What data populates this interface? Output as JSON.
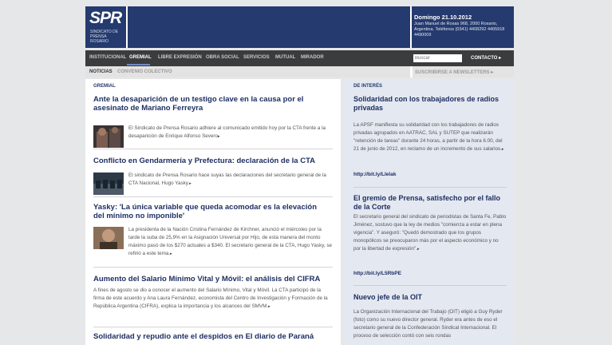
{
  "logo": {
    "text": "SPR",
    "subtitle": "SINDICATO DE PRENSA ROSARIO"
  },
  "date": "Domingo 21.10.2012",
  "address": "Juan Manuel de Rosas 968, 2000 Rosario, Argentina. Teléfonos (0341) 4408292 4405918 4490009",
  "nav": [
    "INSTITUCIONAL",
    "GREMIAL",
    "LIBRE EXPRESIÓN",
    "OBRA SOCIAL",
    "SERVICIOS",
    "MUTUAL",
    "MIRADOR"
  ],
  "search_placeholder": "Buscar",
  "contact": "CONTACTO ▸",
  "subnav": [
    "NOTICIAS",
    "CONVENIO COLECTIVO"
  ],
  "newsletter": "SUSCRIBIRSE A NEWSLETTERS ▸",
  "section": "GREMIAL",
  "articles": [
    {
      "title": "Ante la desaparición de un testigo clave en la causa por el asesinato de Mariano Ferreyra",
      "body": "El Sindicato de Prensa Rosario adhiere al comunicado emitido hoy por la CTA frente a la desaparición de Enrique Alfonso Severo"
    },
    {
      "title": "Conflicto en Gendarmería y Prefectura: declaración de la CTA",
      "body": "El sindicato de Prensa Rosario hace suyas las declaraciones del secretario general de la CTA Nacional, Hugo Yasky."
    },
    {
      "title": "Yasky: 'La única variable que queda acomodar es la elevación del mínimo no imponible'",
      "body": "La presidenta de la Nación Cristina Fernández de Kirchner, anunció el miércoles por la tarde la suba de 25,9% en la Asignación Universal por Hijo, de esta manera del monto máximo pasó de los $270 actuales a $340. El secretario general de la CTA, Hugo Yasky, se refirió a este tema."
    },
    {
      "title": "Aumento del Salario Mínimo Vital y Móvil: el análisis del CIFRA",
      "body": "A fines de agosto se dio a conocer el aumento del Salario Mínimo, Vital y Móvil. La CTA participó de la firma de este acuerdo y Ana Laura Fernández, economista del Centro de Investigación y Formación de la República Argentina (CIFRA), explica la importancia y los alcances del SMVM."
    },
    {
      "title": "Solidaridad y repudio ante el despidos en El diario de Paraná",
      "body": ""
    }
  ],
  "sidebar_section": "DE INTERÉS",
  "sidebar": [
    {
      "title": "Solidaridad con los trabajadores de radios privadas",
      "body": "La APSF manifiesta su solidaridad con los trabajadores de radios privadas agrupados en AATRAC, SAL y SUTEP que realizarán \"retención de tareas\" durante 24 horas, a partir de la hora 6.00, del 21 de junio de 2012, en reclamo de un incremento de sus salarios.",
      "link": "http://bit.ly/Llelak"
    },
    {
      "title": "El gremio de Prensa, satisfecho por el fallo de la Corte",
      "body": "El secretario general del sindicato de periodistas de Santa Fe, Pablo Jiménez, sostuvo que la ley de medios \"comienza a estar en plena vigencia\". Y aseguró: \"Quedó demostrado que los grupos monopólicos se preocuparon más por el aspecto económico y no por la libertad de expresión\".",
      "link": "http://bit.ly/L5RbPE"
    },
    {
      "title": "Nuevo jefe de la OIT",
      "body": "La Organización Internacional del Trabajo (OIT) eligió a Guy Ryder (foto) como su nuevo director general. Ryder era antes de eso el secretario general de la Confederación Sindical Internacional. El proceso de selección contó con seis rondas",
      "link": ""
    }
  ],
  "colors": {
    "brand": "#253a6e",
    "nav": "#3b3c3e",
    "title": "#1e2f63",
    "sidebar_bg": "#e4e8f0"
  }
}
